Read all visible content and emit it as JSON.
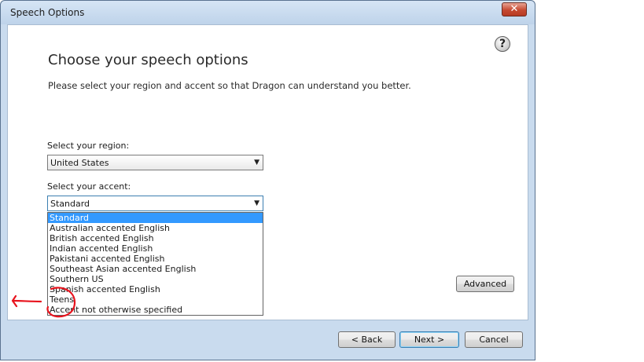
{
  "window": {
    "title": "Speech Options",
    "close_glyph": "✕"
  },
  "page": {
    "help_glyph": "?",
    "title": "Choose your speech options",
    "subtitle": "Please select your region and accent so that Dragon can understand you better."
  },
  "region": {
    "label": "Select your region:",
    "value": "United States"
  },
  "accent": {
    "label": "Select your accent:",
    "value": "Standard",
    "options": [
      "Standard",
      "Australian accented English",
      "British accented English",
      "Indian accented English",
      "Pakistani accented English",
      "Southeast Asian accented English",
      "Southern US",
      "Spanish accented English",
      "Teens",
      "Accent not otherwise specified"
    ],
    "selected_index": 0
  },
  "buttons": {
    "advanced": "Advanced",
    "back": "< Back",
    "next": "Next >",
    "cancel": "Cancel"
  },
  "colors": {
    "annotation": "#e8141e",
    "selection": "#3399ff"
  }
}
